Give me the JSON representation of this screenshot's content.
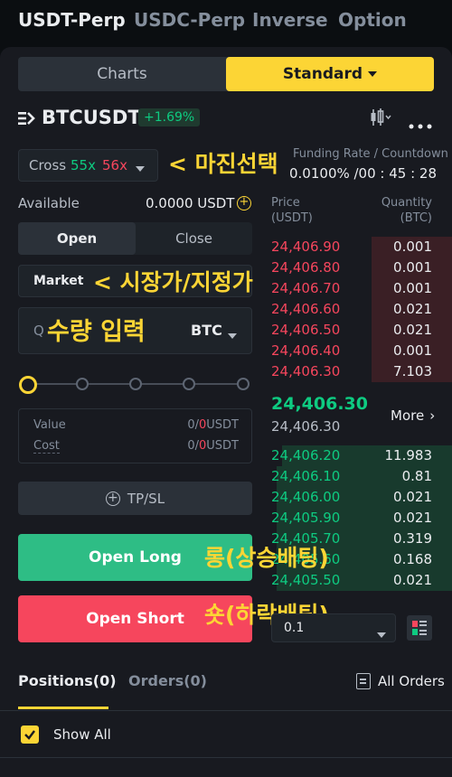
{
  "nav": {
    "tabs": [
      "USDT-Perp",
      "USDC-Perp",
      "Inverse",
      "Option"
    ]
  },
  "view_toggle": {
    "charts": "Charts",
    "standard": "Standard"
  },
  "symbol": {
    "name": "BTCUSDT",
    "change": "+1.69%"
  },
  "margin": {
    "mode": "Cross",
    "long_lev": "55x",
    "short_lev": "56x"
  },
  "funding": {
    "label": "Funding Rate / Countdown",
    "value": "0.0100% /00 : 45 : 28"
  },
  "available": {
    "label": "Available",
    "value": "0.0000 USDT"
  },
  "order_tabs": {
    "open": "Open",
    "close": "Close"
  },
  "order_type": {
    "value": "Market"
  },
  "quantity": {
    "placeholder": "Q",
    "unit": "BTC"
  },
  "value_rows": {
    "value_label": "Value",
    "value_a": "0",
    "value_sep": "/",
    "value_b": "0",
    "value_unit": "USDT",
    "cost_label": "Cost",
    "cost_a": "0",
    "cost_sep": "/",
    "cost_b": "0",
    "cost_unit": "USDT"
  },
  "tpsl": {
    "label": "TP/SL"
  },
  "buttons": {
    "open_long": "Open Long",
    "open_short": "Open Short"
  },
  "annotations": {
    "margin": "< 마진선택",
    "order_type": "< 시장가/지정가",
    "quantity": "수량 입력",
    "long": "롱(상승배팅)",
    "short": "숏(하락배팅)"
  },
  "orderbook": {
    "price_header": "Price\n(USDT)",
    "qty_header": "Quantity\n(BTC)",
    "price_header_1": "Price",
    "price_header_2": "(USDT)",
    "qty_header_1": "Quantity",
    "qty_header_2": "(BTC)",
    "asks": [
      {
        "price": "24,406.90",
        "qty": "0.001"
      },
      {
        "price": "24,406.80",
        "qty": "0.001"
      },
      {
        "price": "24,406.70",
        "qty": "0.001"
      },
      {
        "price": "24,406.60",
        "qty": "0.021"
      },
      {
        "price": "24,406.50",
        "qty": "0.021"
      },
      {
        "price": "24,406.40",
        "qty": "0.001"
      },
      {
        "price": "24,406.30",
        "qty": "7.103"
      }
    ],
    "last_price": "24,406.30",
    "mark_price": "24,406.30",
    "more": "More",
    "bids": [
      {
        "price": "24,406.20",
        "qty": "11.983"
      },
      {
        "price": "24,406.10",
        "qty": "0.81"
      },
      {
        "price": "24,406.00",
        "qty": "0.021"
      },
      {
        "price": "24,405.90",
        "qty": "0.021"
      },
      {
        "price": "24,405.70",
        "qty": "0.319"
      },
      {
        "price": "24,405.60",
        "qty": "0.168"
      },
      {
        "price": "24,405.50",
        "qty": "0.021"
      }
    ],
    "precision": "0.1"
  },
  "bottom": {
    "positions": "Positions(0)",
    "orders": "Orders(0)",
    "all_orders": "All Orders",
    "show_all": "Show All"
  },
  "colors": {
    "accent": "#fcd535",
    "green": "#0ecb81",
    "red": "#f6465d",
    "bg": "#181a20"
  }
}
